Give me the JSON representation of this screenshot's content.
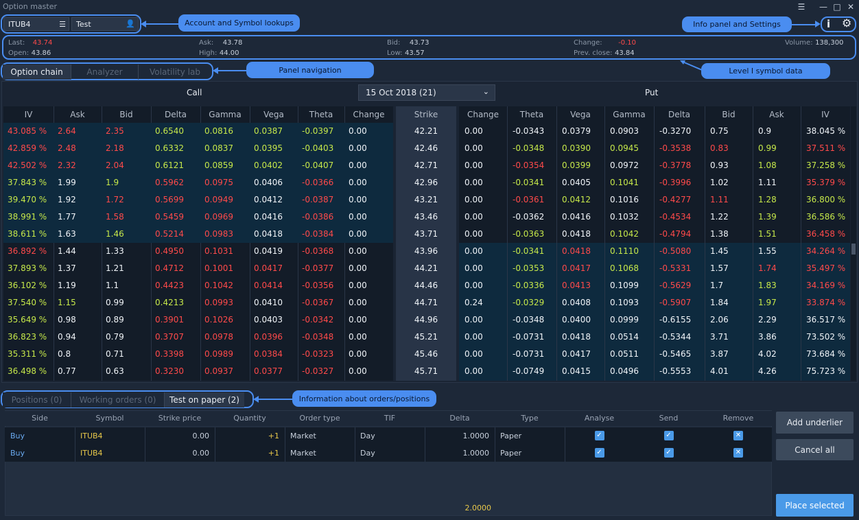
{
  "window": {
    "title": "Option master"
  },
  "lookups": {
    "symbol": "ITUB4",
    "account": "Test"
  },
  "level1": {
    "last_label": "Last:",
    "last": "43.74",
    "open_label": "Open:",
    "open": "43.86",
    "ask_label": "Ask:",
    "ask": "43.78",
    "high_label": "High:",
    "high": "44.00",
    "bid_label": "Bid:",
    "bid": "43.73",
    "low_label": "Low:",
    "low": "43.57",
    "change_label": "Change:",
    "change": "-0.10",
    "prev_label": "Prev. close:",
    "prev": "43.84",
    "volume_label": "Volume:",
    "volume": "138,300"
  },
  "callouts": {
    "lookups": "Account and Symbol lookups",
    "info": "Info panel and Settings",
    "nav": "Panel navigation",
    "level1": "Level I symbol data",
    "orders": "Information about orders/positions"
  },
  "panel_tabs": [
    "Option chain",
    "Analyzer",
    "Volatility lab"
  ],
  "chain": {
    "call_label": "Call",
    "put_label": "Put",
    "expiry": "15 Oct 2018 (21)",
    "call_headers": [
      "IV",
      "Ask",
      "Bid",
      "Delta",
      "Gamma",
      "Vega",
      "Theta",
      "Change"
    ],
    "strike_header": "Strike",
    "put_headers": [
      "Change",
      "Theta",
      "Vega",
      "Gamma",
      "Delta",
      "Bid",
      "Ask",
      "IV"
    ],
    "rows": [
      {
        "c": [
          [
            "43.085 %",
            "r"
          ],
          [
            "2.64",
            "r"
          ],
          [
            "2.35",
            "r"
          ],
          [
            "0.6540",
            "g"
          ],
          [
            "0.0816",
            "g"
          ],
          [
            "0.0387",
            "g"
          ],
          [
            "-0.0397",
            "g"
          ],
          [
            "0.00",
            "w"
          ]
        ],
        "k": "42.21",
        "p": [
          [
            "0.00",
            "w"
          ],
          [
            "-0.0343",
            "w"
          ],
          [
            "0.0379",
            "w"
          ],
          [
            "0.0903",
            "w"
          ],
          [
            "-0.3270",
            "w"
          ],
          [
            "0.75",
            "w"
          ],
          [
            "0.9",
            "w"
          ],
          [
            "38.045 %",
            "w"
          ]
        ]
      },
      {
        "c": [
          [
            "42.859 %",
            "r"
          ],
          [
            "2.48",
            "r"
          ],
          [
            "2.18",
            "r"
          ],
          [
            "0.6332",
            "g"
          ],
          [
            "0.0837",
            "g"
          ],
          [
            "0.0395",
            "g"
          ],
          [
            "-0.0403",
            "g"
          ],
          [
            "0.00",
            "w"
          ]
        ],
        "k": "42.46",
        "p": [
          [
            "0.00",
            "w"
          ],
          [
            "-0.0348",
            "g"
          ],
          [
            "0.0390",
            "g"
          ],
          [
            "0.0945",
            "g"
          ],
          [
            "-0.3538",
            "r"
          ],
          [
            "0.83",
            "r"
          ],
          [
            "0.99",
            "g"
          ],
          [
            "37.511 %",
            "r"
          ]
        ]
      },
      {
        "c": [
          [
            "42.502 %",
            "r"
          ],
          [
            "2.32",
            "r"
          ],
          [
            "2.04",
            "r"
          ],
          [
            "0.6121",
            "g"
          ],
          [
            "0.0859",
            "g"
          ],
          [
            "0.0402",
            "g"
          ],
          [
            "-0.0407",
            "g"
          ],
          [
            "0.00",
            "w"
          ]
        ],
        "k": "42.71",
        "p": [
          [
            "0.00",
            "w"
          ],
          [
            "-0.0354",
            "r"
          ],
          [
            "0.0399",
            "g"
          ],
          [
            "0.0972",
            "w"
          ],
          [
            "-0.3778",
            "r"
          ],
          [
            "0.93",
            "w"
          ],
          [
            "1.08",
            "g"
          ],
          [
            "37.258 %",
            "g"
          ]
        ]
      },
      {
        "c": [
          [
            "37.843 %",
            "g"
          ],
          [
            "1.99",
            "w"
          ],
          [
            "1.9",
            "g"
          ],
          [
            "0.5962",
            "r"
          ],
          [
            "0.0975",
            "r"
          ],
          [
            "0.0406",
            "w"
          ],
          [
            "-0.0366",
            "r"
          ],
          [
            "0.00",
            "w"
          ]
        ],
        "k": "42.96",
        "p": [
          [
            "0.00",
            "w"
          ],
          [
            "-0.0341",
            "g"
          ],
          [
            "0.0405",
            "w"
          ],
          [
            "0.1041",
            "g"
          ],
          [
            "-0.3996",
            "r"
          ],
          [
            "1.02",
            "w"
          ],
          [
            "1.11",
            "w"
          ],
          [
            "35.379 %",
            "r"
          ]
        ]
      },
      {
        "c": [
          [
            "39.470 %",
            "g"
          ],
          [
            "1.92",
            "w"
          ],
          [
            "1.72",
            "r"
          ],
          [
            "0.5699",
            "r"
          ],
          [
            "0.0949",
            "r"
          ],
          [
            "0.0412",
            "w"
          ],
          [
            "-0.0387",
            "r"
          ],
          [
            "0.00",
            "w"
          ]
        ],
        "k": "43.21",
        "p": [
          [
            "0.00",
            "w"
          ],
          [
            "-0.0361",
            "r"
          ],
          [
            "0.0412",
            "g"
          ],
          [
            "0.1016",
            "w"
          ],
          [
            "-0.4277",
            "r"
          ],
          [
            "1.11",
            "r"
          ],
          [
            "1.28",
            "g"
          ],
          [
            "36.800 %",
            "g"
          ]
        ]
      },
      {
        "c": [
          [
            "38.991 %",
            "g"
          ],
          [
            "1.77",
            "w"
          ],
          [
            "1.58",
            "r"
          ],
          [
            "0.5459",
            "r"
          ],
          [
            "0.0969",
            "r"
          ],
          [
            "0.0416",
            "w"
          ],
          [
            "-0.0386",
            "r"
          ],
          [
            "0.00",
            "w"
          ]
        ],
        "k": "43.46",
        "p": [
          [
            "0.00",
            "w"
          ],
          [
            "-0.0362",
            "w"
          ],
          [
            "0.0416",
            "w"
          ],
          [
            "0.1032",
            "w"
          ],
          [
            "-0.4534",
            "r"
          ],
          [
            "1.22",
            "w"
          ],
          [
            "1.39",
            "g"
          ],
          [
            "36.586 %",
            "g"
          ]
        ]
      },
      {
        "c": [
          [
            "38.611 %",
            "g"
          ],
          [
            "1.63",
            "w"
          ],
          [
            "1.46",
            "g"
          ],
          [
            "0.5214",
            "r"
          ],
          [
            "0.0983",
            "r"
          ],
          [
            "0.0418",
            "w"
          ],
          [
            "-0.0384",
            "r"
          ],
          [
            "0.00",
            "w"
          ]
        ],
        "k": "43.71",
        "p": [
          [
            "0.00",
            "w"
          ],
          [
            "-0.0363",
            "g"
          ],
          [
            "0.0418",
            "w"
          ],
          [
            "0.1042",
            "g"
          ],
          [
            "-0.4794",
            "r"
          ],
          [
            "1.38",
            "w"
          ],
          [
            "1.51",
            "g"
          ],
          [
            "36.458 %",
            "r"
          ]
        ]
      },
      {
        "c": [
          [
            "36.892 %",
            "r"
          ],
          [
            "1.44",
            "w"
          ],
          [
            "1.33",
            "w"
          ],
          [
            "0.4950",
            "r"
          ],
          [
            "0.1031",
            "r"
          ],
          [
            "0.0419",
            "w"
          ],
          [
            "-0.0368",
            "r"
          ],
          [
            "0.00",
            "w"
          ]
        ],
        "k": "43.96",
        "p": [
          [
            "0.00",
            "w"
          ],
          [
            "-0.0341",
            "g"
          ],
          [
            "0.0418",
            "r"
          ],
          [
            "0.1110",
            "g"
          ],
          [
            "-0.5080",
            "r"
          ],
          [
            "1.45",
            "w"
          ],
          [
            "1.55",
            "w"
          ],
          [
            "34.264 %",
            "r"
          ]
        ]
      },
      {
        "c": [
          [
            "37.893 %",
            "g"
          ],
          [
            "1.37",
            "w"
          ],
          [
            "1.21",
            "w"
          ],
          [
            "0.4712",
            "r"
          ],
          [
            "0.1001",
            "r"
          ],
          [
            "0.0417",
            "r"
          ],
          [
            "-0.0377",
            "r"
          ],
          [
            "0.00",
            "w"
          ]
        ],
        "k": "44.21",
        "p": [
          [
            "0.00",
            "w"
          ],
          [
            "-0.0353",
            "g"
          ],
          [
            "0.0417",
            "r"
          ],
          [
            "0.1068",
            "g"
          ],
          [
            "-0.5331",
            "r"
          ],
          [
            "1.57",
            "w"
          ],
          [
            "1.74",
            "r"
          ],
          [
            "35.497 %",
            "r"
          ]
        ]
      },
      {
        "c": [
          [
            "36.102 %",
            "g"
          ],
          [
            "1.19",
            "w"
          ],
          [
            "1.1",
            "w"
          ],
          [
            "0.4423",
            "r"
          ],
          [
            "0.1042",
            "r"
          ],
          [
            "0.0414",
            "r"
          ],
          [
            "-0.0356",
            "r"
          ],
          [
            "0.00",
            "w"
          ]
        ],
        "k": "44.46",
        "p": [
          [
            "0.00",
            "w"
          ],
          [
            "-0.0336",
            "g"
          ],
          [
            "0.0413",
            "r"
          ],
          [
            "0.1099",
            "w"
          ],
          [
            "-0.5629",
            "r"
          ],
          [
            "1.7",
            "w"
          ],
          [
            "1.83",
            "g"
          ],
          [
            "34.169 %",
            "r"
          ]
        ]
      },
      {
        "c": [
          [
            "37.540 %",
            "g"
          ],
          [
            "1.15",
            "g"
          ],
          [
            "0.99",
            "w"
          ],
          [
            "0.4213",
            "g"
          ],
          [
            "0.0993",
            "r"
          ],
          [
            "0.0410",
            "w"
          ],
          [
            "-0.0367",
            "r"
          ],
          [
            "0.00",
            "w"
          ]
        ],
        "k": "44.71",
        "p": [
          [
            "0.24",
            "w"
          ],
          [
            "-0.0329",
            "g"
          ],
          [
            "0.0408",
            "w"
          ],
          [
            "0.1093",
            "w"
          ],
          [
            "-0.5907",
            "r"
          ],
          [
            "1.84",
            "w"
          ],
          [
            "1.97",
            "g"
          ],
          [
            "33.874 %",
            "r"
          ]
        ]
      },
      {
        "c": [
          [
            "35.649 %",
            "g"
          ],
          [
            "0.98",
            "w"
          ],
          [
            "0.89",
            "w"
          ],
          [
            "0.3901",
            "r"
          ],
          [
            "0.1026",
            "r"
          ],
          [
            "0.0403",
            "w"
          ],
          [
            "-0.0342",
            "r"
          ],
          [
            "0.00",
            "w"
          ]
        ],
        "k": "44.96",
        "p": [
          [
            "0.00",
            "w"
          ],
          [
            "-0.0348",
            "w"
          ],
          [
            "0.0400",
            "w"
          ],
          [
            "0.0999",
            "w"
          ],
          [
            "-0.6155",
            "w"
          ],
          [
            "2.06",
            "w"
          ],
          [
            "2.29",
            "w"
          ],
          [
            "36.517 %",
            "w"
          ]
        ]
      },
      {
        "c": [
          [
            "36.823 %",
            "g"
          ],
          [
            "0.94",
            "w"
          ],
          [
            "0.79",
            "w"
          ],
          [
            "0.3707",
            "r"
          ],
          [
            "0.0978",
            "r"
          ],
          [
            "0.0396",
            "r"
          ],
          [
            "-0.0348",
            "r"
          ],
          [
            "0.00",
            "w"
          ]
        ],
        "k": "45.21",
        "p": [
          [
            "0.00",
            "w"
          ],
          [
            "-0.0731",
            "w"
          ],
          [
            "0.0418",
            "w"
          ],
          [
            "0.0514",
            "w"
          ],
          [
            "-0.5344",
            "w"
          ],
          [
            "3.71",
            "w"
          ],
          [
            "3.86",
            "w"
          ],
          [
            "73.502 %",
            "w"
          ]
        ]
      },
      {
        "c": [
          [
            "35.311 %",
            "g"
          ],
          [
            "0.8",
            "w"
          ],
          [
            "0.71",
            "w"
          ],
          [
            "0.3398",
            "r"
          ],
          [
            "0.0989",
            "r"
          ],
          [
            "0.0384",
            "r"
          ],
          [
            "-0.0323",
            "r"
          ],
          [
            "0.00",
            "w"
          ]
        ],
        "k": "45.46",
        "p": [
          [
            "0.00",
            "w"
          ],
          [
            "-0.0731",
            "w"
          ],
          [
            "0.0417",
            "w"
          ],
          [
            "0.0511",
            "w"
          ],
          [
            "-0.5465",
            "w"
          ],
          [
            "3.87",
            "w"
          ],
          [
            "4.02",
            "w"
          ],
          [
            "73.684 %",
            "w"
          ]
        ]
      },
      {
        "c": [
          [
            "36.498 %",
            "g"
          ],
          [
            "0.77",
            "w"
          ],
          [
            "0.63",
            "w"
          ],
          [
            "0.3230",
            "r"
          ],
          [
            "0.0937",
            "r"
          ],
          [
            "0.0377",
            "r"
          ],
          [
            "-0.0327",
            "r"
          ],
          [
            "0.00",
            "w"
          ]
        ],
        "k": "45.71",
        "p": [
          [
            "0.00",
            "w"
          ],
          [
            "-0.0749",
            "w"
          ],
          [
            "0.0415",
            "w"
          ],
          [
            "0.0496",
            "w"
          ],
          [
            "-0.5553",
            "w"
          ],
          [
            "4.01",
            "w"
          ],
          [
            "4.26",
            "w"
          ],
          [
            "75.723 %",
            "w"
          ]
        ]
      }
    ]
  },
  "order_tabs": [
    "Positions (0)",
    "Working orders (0)",
    "Test on paper (2)"
  ],
  "orders": {
    "headers": [
      "Side",
      "Symbol",
      "Strike price",
      "Quantity",
      "Order type",
      "TIF",
      "Delta",
      "Type",
      "Analyse",
      "Send",
      "Remove"
    ],
    "rows": [
      {
        "side": "Buy",
        "symbol": "ITUB4",
        "strike": "0.00",
        "qty": "+1",
        "otype": "Market",
        "tif": "Day",
        "delta": "1.0000",
        "type": "Paper"
      },
      {
        "side": "Buy",
        "symbol": "ITUB4",
        "strike": "0.00",
        "qty": "+1",
        "otype": "Market",
        "tif": "Day",
        "delta": "1.0000",
        "type": "Paper"
      }
    ],
    "total_delta": "2.0000"
  },
  "buttons": {
    "add_underlier": "Add underlier",
    "cancel_all": "Cancel all",
    "place_selected": "Place selected"
  },
  "colors": {
    "red": "#ff4a4a",
    "green": "#c6e84a",
    "accent": "#4a8df0"
  }
}
